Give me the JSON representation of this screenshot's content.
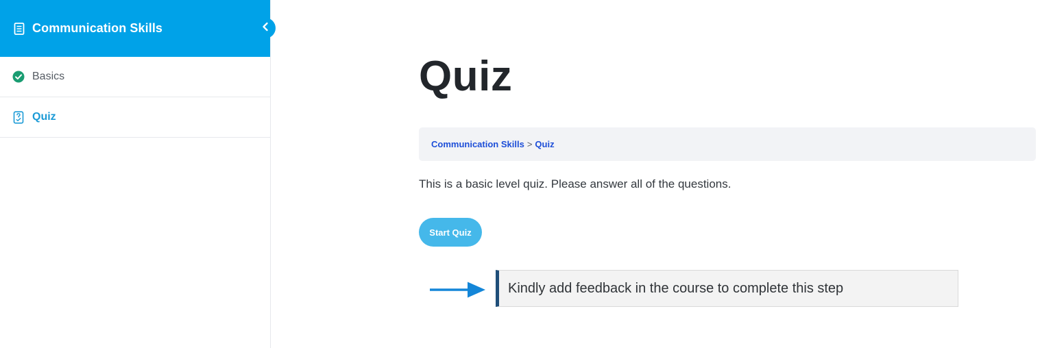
{
  "sidebar": {
    "course_title": "Communication Skills",
    "icons": {
      "course": "document-icon",
      "collapse": "chevron-left-icon"
    },
    "items": [
      {
        "label": "Basics",
        "icon": "check-circle-icon",
        "state": "completed"
      },
      {
        "label": "Quiz",
        "icon": "quiz-icon",
        "state": "active"
      }
    ]
  },
  "main": {
    "title": "Quiz",
    "breadcrumb": {
      "course": "Communication Skills",
      "separator": ">",
      "current": "Quiz"
    },
    "description": "This is a basic level quiz. Please answer all of the questions.",
    "start_button": "Start Quiz",
    "notice": "Kindly add feedback in the course to complete this step"
  },
  "colors": {
    "accent": "#00a2e8",
    "button": "#45b8ea",
    "completed": "#1a9d72",
    "link": "#1d4ed8",
    "notice_border": "#1f4e79",
    "arrow": "#1486d8"
  }
}
